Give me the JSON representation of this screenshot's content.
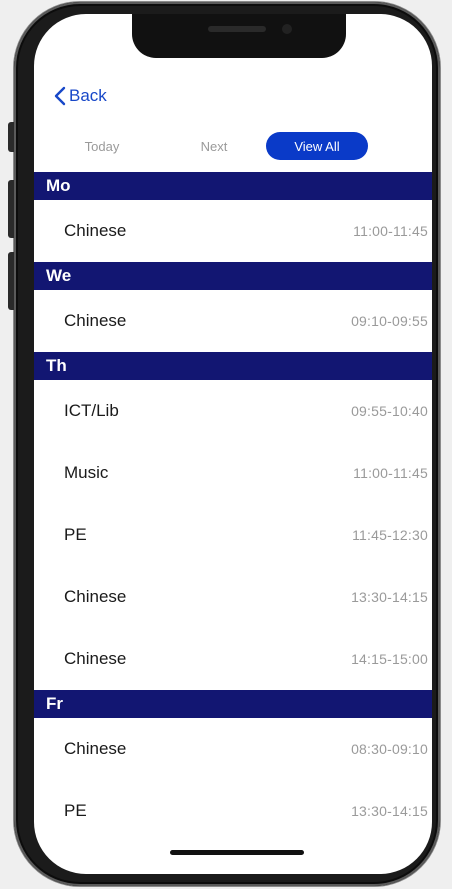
{
  "nav": {
    "back_label": "Back"
  },
  "filters": {
    "today": "Today",
    "next": "Next",
    "view_all": "View All"
  },
  "schedule": [
    {
      "day": "Mo",
      "lessons": [
        {
          "subject": "Chinese",
          "time": "11:00-11:45"
        }
      ]
    },
    {
      "day": "We",
      "lessons": [
        {
          "subject": "Chinese",
          "time": "09:10-09:55"
        }
      ]
    },
    {
      "day": "Th",
      "lessons": [
        {
          "subject": "ICT/Lib",
          "time": "09:55-10:40"
        },
        {
          "subject": "Music",
          "time": "11:00-11:45"
        },
        {
          "subject": "PE",
          "time": "11:45-12:30"
        },
        {
          "subject": "Chinese",
          "time": "13:30-14:15"
        },
        {
          "subject": "Chinese",
          "time": "14:15-15:00"
        }
      ]
    },
    {
      "day": "Fr",
      "lessons": [
        {
          "subject": "Chinese",
          "time": "08:30-09:10"
        },
        {
          "subject": "PE",
          "time": "13:30-14:15"
        }
      ]
    }
  ],
  "colors": {
    "accent": "#0a3ac8",
    "day_header": "#121672",
    "link": "#1747c8"
  }
}
